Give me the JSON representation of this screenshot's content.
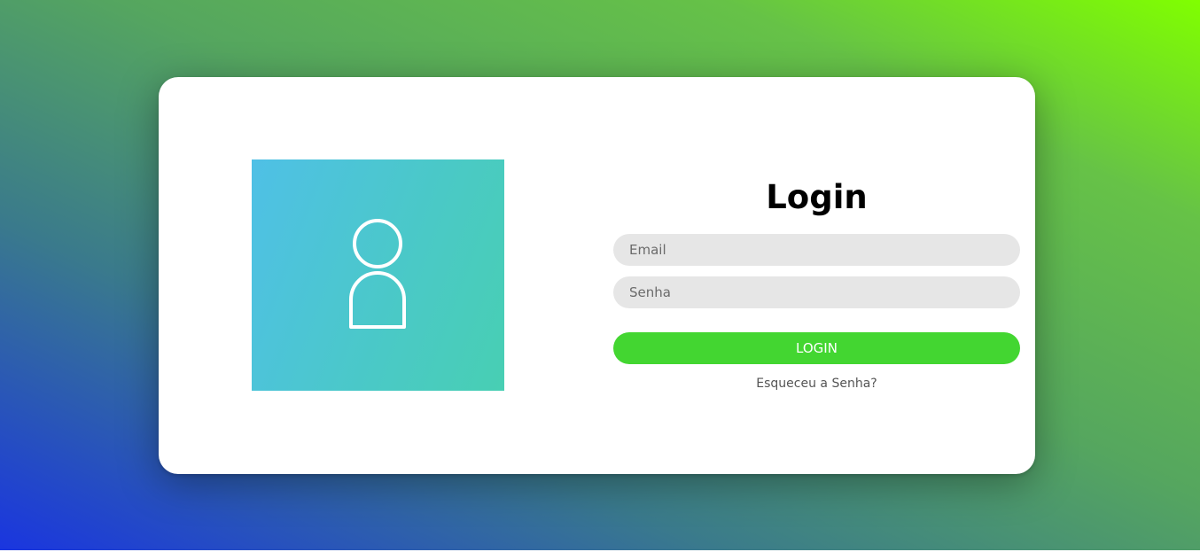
{
  "login": {
    "title": "Login",
    "email_placeholder": "Email",
    "password_placeholder": "Senha",
    "submit_label": "LOGIN",
    "forgot_label": "Esqueceu a Senha?"
  },
  "icons": {
    "avatar": "user-icon"
  },
  "colors": {
    "primary_button": "#43d631",
    "input_background": "#e6e6e6",
    "avatar_gradient_start": "#4fc0e6",
    "avatar_gradient_end": "#48cfb3"
  }
}
